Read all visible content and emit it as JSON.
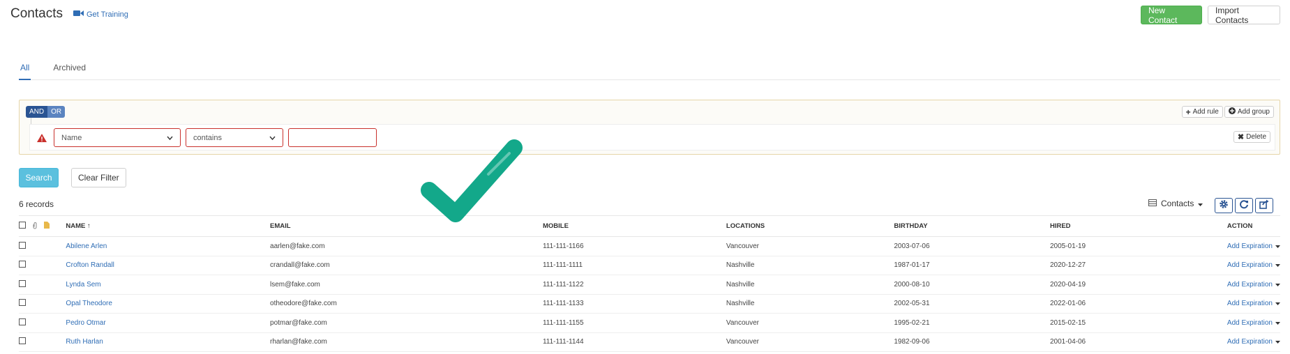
{
  "header": {
    "title": "Contacts",
    "training_label": "Get Training",
    "new_contact_label": "New Contact",
    "import_contacts_label": "Import Contacts"
  },
  "tabs": [
    {
      "label": "All",
      "active": true
    },
    {
      "label": "Archived",
      "active": false
    }
  ],
  "filter": {
    "and_label": "AND",
    "or_label": "OR",
    "add_rule_label": "Add rule",
    "add_group_label": "Add group",
    "field_value": "Name",
    "operator_value": "contains",
    "input_value": "",
    "delete_label": "Delete"
  },
  "actions": {
    "search_label": "Search",
    "clear_filter_label": "Clear Filter"
  },
  "list": {
    "record_count": "6 records",
    "view_label": "Contacts"
  },
  "table": {
    "headers": {
      "name": "NAME ↑",
      "email": "EMAIL",
      "mobile": "MOBILE",
      "locations": "LOCATIONS",
      "birthday": "BIRTHDAY",
      "hired": "HIRED",
      "action": "ACTION"
    },
    "rows": [
      {
        "name": "Abilene Arlen",
        "email": "aarlen@fake.com",
        "mobile": "111-111-1166",
        "location": "Vancouver",
        "birthday": "2003-07-06",
        "hired": "2005-01-19",
        "action": "Add Expiration"
      },
      {
        "name": "Crofton Randall",
        "email": "crandall@fake.com",
        "mobile": "111-111-1111",
        "location": "Nashville",
        "birthday": "1987-01-17",
        "hired": "2020-12-27",
        "action": "Add Expiration"
      },
      {
        "name": "Lynda Sem",
        "email": "lsem@fake.com",
        "mobile": "111-111-1122",
        "location": "Nashville",
        "birthday": "2000-08-10",
        "hired": "2020-04-19",
        "action": "Add Expiration"
      },
      {
        "name": "Opal Theodore",
        "email": "otheodore@fake.com",
        "mobile": "111-111-1133",
        "location": "Nashville",
        "birthday": "2002-05-31",
        "hired": "2022-01-06",
        "action": "Add Expiration"
      },
      {
        "name": "Pedro Otmar",
        "email": "potmar@fake.com",
        "mobile": "111-111-1155",
        "location": "Vancouver",
        "birthday": "1995-02-21",
        "hired": "2015-02-15",
        "action": "Add Expiration"
      },
      {
        "name": "Ruth Harlan",
        "email": "rharlan@fake.com",
        "mobile": "111-111-1144",
        "location": "Vancouver",
        "birthday": "1982-09-06",
        "hired": "2001-04-06",
        "action": "Add Expiration"
      }
    ]
  },
  "colors": {
    "primary_blue": "#2f6db5",
    "green_button": "#5cb85c",
    "search_button": "#5bc0de",
    "checkmark": "#13a88a",
    "filter_border": "#e5d5a8",
    "error_border": "#c9302c"
  },
  "icons": {
    "training": "video-camera-icon",
    "warning": "warning-triangle-icon",
    "attachment": "paperclip-icon",
    "note": "note-icon",
    "settings": "gear-icon",
    "refresh": "refresh-icon",
    "export": "share-icon",
    "checkmark": "checkmark-icon"
  }
}
